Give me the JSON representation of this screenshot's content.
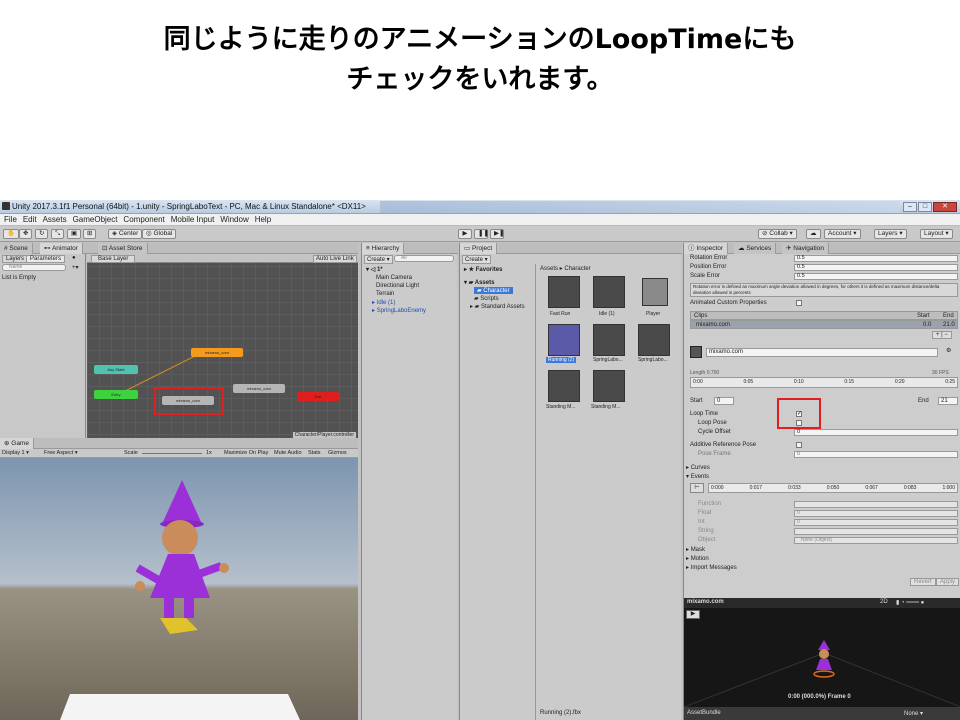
{
  "caption": {
    "line1": "同じように走りのアニメーションのLoopTimeにも",
    "line2": "チェックをいれます。"
  },
  "window": {
    "title": "Unity 2017.3.1f1 Personal (64bit) - 1.unity - SpringLaboText - PC, Mac & Linux Standalone* <DX11>"
  },
  "menu": [
    "File",
    "Edit",
    "Assets",
    "GameObject",
    "Component",
    "Mobile Input",
    "Window",
    "Help"
  ],
  "toolbar": {
    "center": "Center",
    "global": "Global",
    "collab": "Collab",
    "account": "Account",
    "layers": "Layers",
    "layout": "Layout"
  },
  "scene_tabs": {
    "scene": "Scene",
    "animator": "Animator",
    "asset_store": "Asset Store"
  },
  "animator": {
    "layers_tab": "Layers",
    "params_tab": "Parameters",
    "search_ph": "Name",
    "list_empty": "List is Empty",
    "base_layer": "Base Layer",
    "auto_live": "Auto Live Link",
    "states": {
      "entry": "Entry",
      "any": "Any State",
      "running": "mixamo_com",
      "idle": "mixamo_com",
      "other": "mixamo_com",
      "exit": "Exit"
    },
    "controller": "Character/Player.controller"
  },
  "game": {
    "tab": "Game",
    "display": "Display 1",
    "aspect": "Free Aspect",
    "scale": "Scale",
    "scale_val": "1x",
    "maximize": "Maximize On Play",
    "mute": "Mute Audio",
    "stats": "Stats",
    "gizmos": "Gizmos"
  },
  "hierarchy": {
    "tab": "Hierarchy",
    "create": "Create",
    "search_ph": "All",
    "scene": "1*",
    "items": [
      "Main Camera",
      "Directional Light",
      "Terrain",
      "Idle (1)",
      "SpringLaboEnemy"
    ]
  },
  "project": {
    "tab": "Project",
    "create": "Create",
    "favorites": "Favorites",
    "assets": "Assets",
    "tree": [
      "Character",
      "Scripts",
      "Standard Assets"
    ],
    "breadcrumb": "Assets ▸ Character",
    "items": [
      "Fast Run",
      "Idle (1)",
      "Player",
      "Running (2)",
      "SpringLabo...",
      "SpringLabo...",
      "Standing M...",
      "Standing M..."
    ],
    "footer": "Running (2).fbx"
  },
  "inspector": {
    "tabs": [
      "Inspector",
      "Services",
      "Navigation"
    ],
    "rot_error_label": "Rotation Error",
    "rot_error": "0.5",
    "pos_error_label": "Position Error",
    "pos_error": "0.5",
    "scale_error_label": "Scale Error",
    "scale_error": "0.5",
    "note": "Rotation error is defined as maximum angle deviation allowed in degrees, for others it is defined as maximum distance/delta deviation allowed in percents",
    "custom_props": "Animated Custom Properties",
    "clips_label": "Clips",
    "start_label": "Start",
    "end_label": "End",
    "clip_name": "mixamo.com",
    "clip_start": "0.0",
    "clip_end": "21.0",
    "clip_field": "mixamo.com",
    "length_label": "Length",
    "length_val": "0.700",
    "fps": "30 FPS",
    "ticks": [
      "0:00",
      "0:05",
      "0:10",
      "0:15",
      "0:20",
      "0:25"
    ],
    "start_field_label": "Start",
    "start_val": "0",
    "end_field_label": "End",
    "end_val": "21",
    "loop_time": "Loop Time",
    "loop_pose": "Loop Pose",
    "cycle_offset": "Cycle Offset",
    "cycle_val": "0",
    "additive": "Additive Reference Pose",
    "pose_frame": "Pose Frame",
    "pose_val": "0",
    "curves": "Curves",
    "events": "Events",
    "event_ticks": [
      "0:000",
      "0:017",
      "0:033",
      "0:050",
      "0:067",
      "0:083",
      "1:000"
    ],
    "function_label": "Function",
    "float_label": "Float",
    "float_val": "0",
    "int_label": "Int",
    "int_val": "0",
    "string_label": "String",
    "object_label": "Object",
    "object_val": "None (Object)",
    "mask": "Mask",
    "motion": "Motion",
    "import_messages": "Import Messages",
    "revert": "Revert",
    "apply": "Apply",
    "preview_name": "mixamo.com",
    "preview_2d": "2D",
    "preview_time": "0:00 (000.0%) Frame 0",
    "assetbundle": "AssetBundle",
    "none": "None"
  }
}
